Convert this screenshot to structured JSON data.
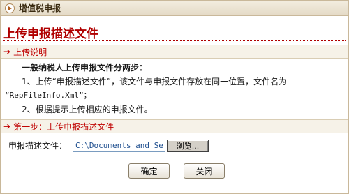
{
  "window": {
    "title": "增值税申报"
  },
  "page": {
    "heading": "上传申报描述文件"
  },
  "instructions": {
    "section_label": "上传说明",
    "lead": "一般纳税人上传申报文件分两步：",
    "step1": "1、上传“申报描述文件”，该文件与申报文件存放在同一位置，文件名为",
    "step1_filename": "“RepFileInfo.Xml”；",
    "step2": "2、根据提示上传相应的申报文件。"
  },
  "step_one": {
    "section_label": "第一步：上传申报描述文件",
    "field_label": "申报描述文件：",
    "file_value": "C:\\Documents and Sett",
    "browse_label": "浏览..."
  },
  "actions": {
    "confirm_label": "确定",
    "close_label": "关闭"
  },
  "icons": {
    "title_icon": "play-circle-icon",
    "section_icon": "arrow-right-icon"
  },
  "colors": {
    "accent": "#b00000",
    "section_bg": "#f6f2e8",
    "titlebar_bg": "#e4dac6"
  }
}
